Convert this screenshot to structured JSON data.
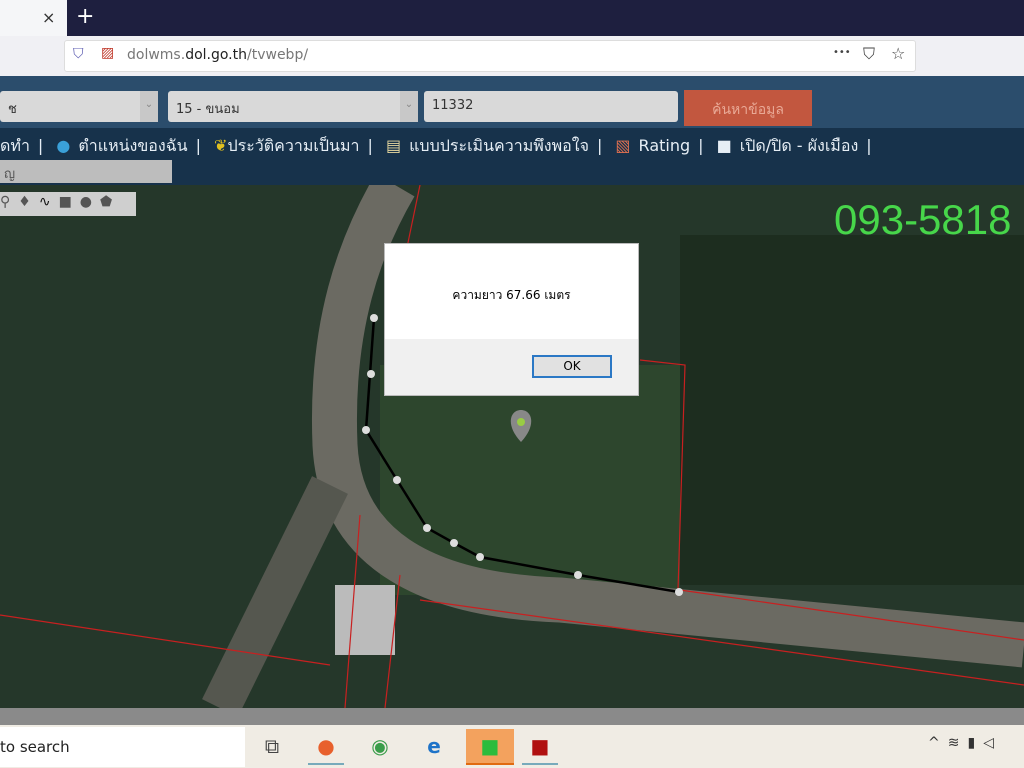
{
  "browser": {
    "url_host_prefix": "dolwms.",
    "url_host": "dol.go.th",
    "url_path": "/tvwebp/",
    "tab_close": "×",
    "new_tab": "+",
    "menu_dots": "•••"
  },
  "toolbar": {
    "province_value": "ช",
    "district_value": "15 - ขนอม",
    "parcel_value": "11332",
    "search_label": "ค้นหาข้อมูล"
  },
  "menu": {
    "items": [
      "ดทำ",
      "ตำแหน่งของฉัน",
      "ประวัติความเป็นมา",
      "แบบประเมินความพึงพอใจ",
      "Rating",
      "เปิด/ปิด - ผังเมือง"
    ],
    "separator": "|",
    "sub_input_value": "ญ"
  },
  "map": {
    "phone_overlay": "093-5818",
    "overlay_color": "#47d64a",
    "parcel_line_color": "#d02020"
  },
  "dialog": {
    "message": "ความยาว 67.66 เมตร",
    "ok_label": "OK"
  },
  "taskbar": {
    "search_text": "to search",
    "apps": [
      "task-view",
      "firefox",
      "chrome",
      "edge",
      "line",
      "acrobat"
    ]
  }
}
